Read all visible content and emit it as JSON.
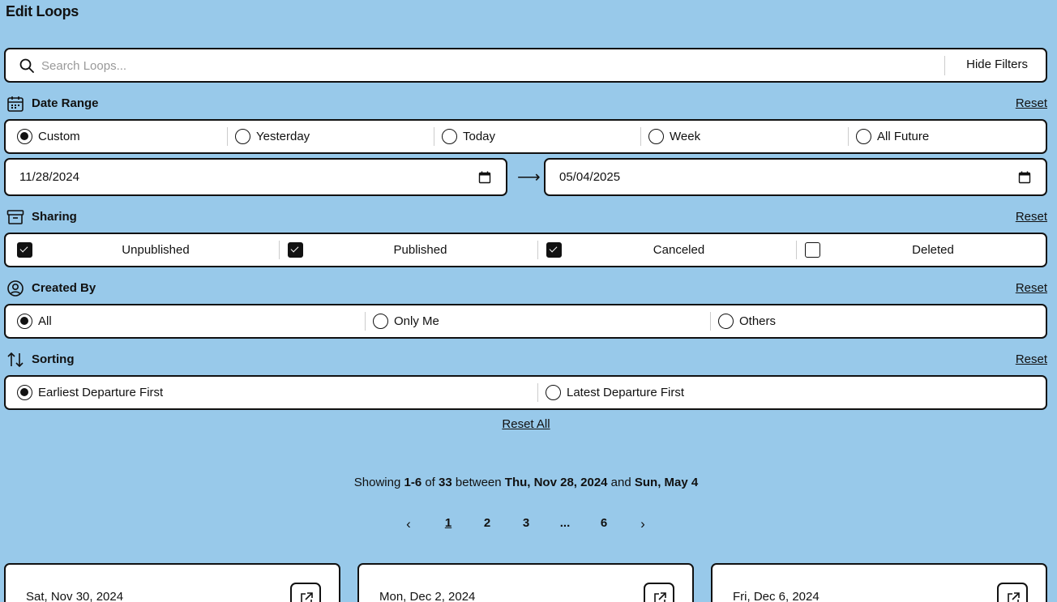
{
  "title": "Edit Loops",
  "search": {
    "placeholder": "Search Loops...",
    "hide_filters_label": "Hide Filters"
  },
  "date_range": {
    "label": "Date Range",
    "reset_label": "Reset",
    "options": [
      "Custom",
      "Yesterday",
      "Today",
      "Week",
      "All Future"
    ],
    "selected": "Custom",
    "start_date": "11/28/2024",
    "end_date": "05/04/2025",
    "arrow": "⟶"
  },
  "sharing": {
    "label": "Sharing",
    "reset_label": "Reset",
    "options": [
      {
        "label": "Unpublished",
        "checked": true
      },
      {
        "label": "Published",
        "checked": true
      },
      {
        "label": "Canceled",
        "checked": true
      },
      {
        "label": "Deleted",
        "checked": false
      }
    ]
  },
  "created_by": {
    "label": "Created By",
    "reset_label": "Reset",
    "options": [
      "All",
      "Only Me",
      "Others"
    ],
    "selected": "All"
  },
  "sorting": {
    "label": "Sorting",
    "reset_label": "Reset",
    "options": [
      "Earliest Departure First",
      "Latest Departure First"
    ],
    "selected": "Earliest Departure First"
  },
  "reset_all_label": "Reset All",
  "results": {
    "prefix": "Showing",
    "range": "1-6",
    "of": "of",
    "total": "33",
    "between": "between",
    "start": "Thu, Nov 28, 2024",
    "and": "and",
    "end": "Sun, May 4"
  },
  "pagination": {
    "prev": "‹",
    "pages": [
      "1",
      "2",
      "3",
      "...",
      "6"
    ],
    "current": "1",
    "next": "›"
  },
  "cards": [
    {
      "date": "Sat, Nov 30, 2024"
    },
    {
      "date": "Mon, Dec 2, 2024"
    },
    {
      "date": "Fri, Dec 6, 2024"
    }
  ],
  "icons": {
    "search": "search-icon",
    "calendar": "calendar-icon",
    "archive": "archive-icon",
    "user": "user-circle-icon",
    "sort": "sort-arrows-icon",
    "external": "external-link-icon"
  }
}
